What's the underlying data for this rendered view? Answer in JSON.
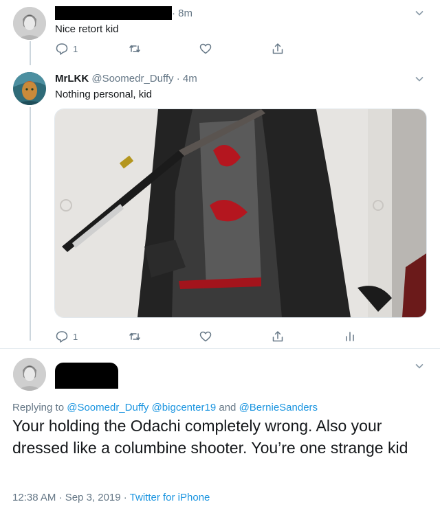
{
  "tweets": [
    {
      "avatar": "profile-photo",
      "handle_redacted": true,
      "time": "· 8m",
      "text": "Nice retort kid",
      "reply_count": "1",
      "actions": [
        "reply-icon",
        "retweet-icon",
        "like-icon",
        "share-icon"
      ]
    },
    {
      "avatar": "painting-avatar",
      "name": "MrLKK",
      "handle": "@Soomedr_Duffy",
      "time": "· 4m",
      "text": "Nothing personal, kid",
      "reply_count": "1",
      "actions": [
        "reply-icon",
        "retweet-icon",
        "like-icon",
        "share-icon",
        "analytics-icon"
      ]
    }
  ],
  "main_tweet": {
    "avatar": "profile-photo",
    "name_redacted": true,
    "replying_prefix": "Replying to ",
    "replying_to": [
      "@Soomedr_Duffy",
      "@bigcenter19",
      "@BernieSanders"
    ],
    "replying_and": " and ",
    "text": "Your holding the Odachi completely wrong. Also your dressed like a columbine shooter. You’re one strange kid",
    "timestamp": "12:38 AM · Sep 3, 2019 · ",
    "source": "Twitter for iPhone"
  },
  "colors": {
    "link": "#1b95e0",
    "muted": "#657786",
    "divider": "#e6ecf0"
  }
}
